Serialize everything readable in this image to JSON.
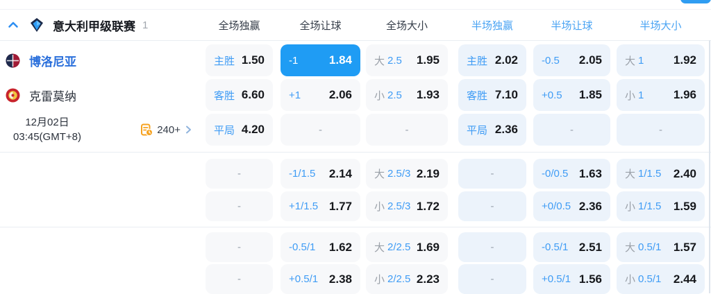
{
  "colors": {
    "accent": "#1f9cf4",
    "half_header": "#49a3f3",
    "label_blue": "#3f9cf5",
    "team_blue": "#2a6fdb",
    "orange": "#f6a21f"
  },
  "header": {
    "league": "意大利甲级联赛",
    "count": "1",
    "columns": [
      {
        "label": "全场独赢",
        "period": "full"
      },
      {
        "label": "全场让球",
        "period": "full"
      },
      {
        "label": "全场大小",
        "period": "full"
      },
      {
        "label": "半场独赢",
        "period": "half"
      },
      {
        "label": "半场让球",
        "period": "half"
      },
      {
        "label": "半场大小",
        "period": "half"
      }
    ]
  },
  "match": {
    "home": "博洛尼亚",
    "away": "克雷莫纳",
    "date": "12月02日",
    "time": "03:45(GMT+8)",
    "more_markets": "240+"
  },
  "icons": {
    "collapse": "chevron-up",
    "league": "serie-a-logo",
    "home": "bologna-crest",
    "away": "cremonese-crest",
    "markets": "list-clock",
    "expand": "chevron-right"
  },
  "rows": [
    {
      "cells": [
        {
          "label": "主胜",
          "odds": "1.50"
        },
        {
          "line": "-1",
          "odds": "1.84",
          "selected": true
        },
        {
          "prefix": "大",
          "line": "2.5",
          "odds": "1.95"
        },
        {
          "label": "主胜",
          "odds": "2.02"
        },
        {
          "line": "-0.5",
          "odds": "2.05"
        },
        {
          "prefix": "大",
          "line": "1",
          "odds": "1.92"
        }
      ]
    },
    {
      "cells": [
        {
          "label": "客胜",
          "odds": "6.60"
        },
        {
          "line": "+1",
          "odds": "2.06"
        },
        {
          "prefix": "小",
          "line": "2.5",
          "odds": "1.93"
        },
        {
          "label": "客胜",
          "odds": "7.10"
        },
        {
          "line": "+0.5",
          "odds": "1.85"
        },
        {
          "prefix": "小",
          "line": "1",
          "odds": "1.96"
        }
      ]
    },
    {
      "cells": [
        {
          "label": "平局",
          "odds": "4.20"
        },
        {
          "dash": "-"
        },
        {
          "dash": "-"
        },
        {
          "label": "平局",
          "odds": "2.36"
        },
        {
          "dash": "-"
        },
        {
          "dash": "-"
        }
      ]
    },
    {
      "cells": [
        {
          "dash": "-"
        },
        {
          "line": "-1/1.5",
          "odds": "2.14"
        },
        {
          "prefix": "大",
          "line": "2.5/3",
          "odds": "2.19"
        },
        {
          "dash": "-"
        },
        {
          "line": "-0/0.5",
          "odds": "1.63"
        },
        {
          "prefix": "大",
          "line": "1/1.5",
          "odds": "2.40"
        }
      ]
    },
    {
      "cells": [
        {
          "dash": "-"
        },
        {
          "line": "+1/1.5",
          "odds": "1.77"
        },
        {
          "prefix": "小",
          "line": "2.5/3",
          "odds": "1.72"
        },
        {
          "dash": "-"
        },
        {
          "line": "+0/0.5",
          "odds": "2.36"
        },
        {
          "prefix": "小",
          "line": "1/1.5",
          "odds": "1.59"
        }
      ]
    },
    {
      "cells": [
        {
          "dash": "-"
        },
        {
          "line": "-0.5/1",
          "odds": "1.62"
        },
        {
          "prefix": "大",
          "line": "2/2.5",
          "odds": "1.69"
        },
        {
          "dash": "-"
        },
        {
          "line": "-0.5/1",
          "odds": "2.51"
        },
        {
          "prefix": "大",
          "line": "0.5/1",
          "odds": "1.57"
        }
      ]
    },
    {
      "cells": [
        {
          "dash": "-"
        },
        {
          "line": "+0.5/1",
          "odds": "2.38"
        },
        {
          "prefix": "小",
          "line": "2/2.5",
          "odds": "2.23"
        },
        {
          "dash": "-"
        },
        {
          "line": "+0.5/1",
          "odds": "1.56"
        },
        {
          "prefix": "小",
          "line": "0.5/1",
          "odds": "2.44"
        }
      ]
    }
  ]
}
